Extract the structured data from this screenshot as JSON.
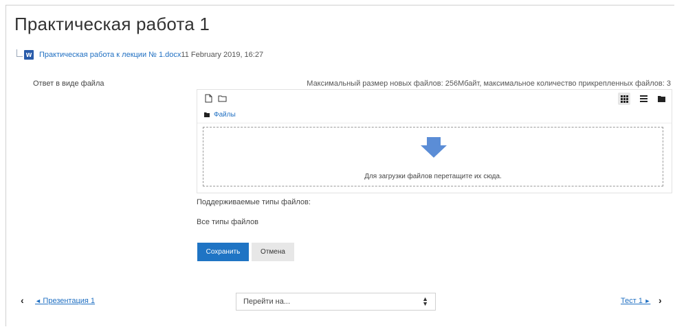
{
  "page": {
    "title": "Практическая работа 1"
  },
  "attachment": {
    "icon": "word-document-icon",
    "link_text": "Практическая работа к лекции № 1.docx",
    "date": "11 February 2019, 16:27"
  },
  "submission": {
    "field_label": "Ответ в виде файла",
    "limits_text": "Максимальный размер новых файлов: 256Мбайт, максимальное количество прикрепленных файлов: 3"
  },
  "file_manager": {
    "toolbar": {
      "add_file_icon": "file-icon",
      "create_folder_icon": "folder-outline-icon",
      "view_icons": "grid-view-icon",
      "view_list": "list-view-icon",
      "view_tree": "tree-view-icon"
    },
    "path_label": "Файлы",
    "drop_text": "Для загрузки файлов перетащите их сюда.",
    "arrow_color": "#5b8dd6"
  },
  "accepted_types": {
    "label": "Поддерживаемые типы файлов:",
    "value": "Все типы файлов"
  },
  "buttons": {
    "save": "Сохранить",
    "cancel": "Отмена"
  },
  "navigation": {
    "prev_label": "Презентация 1",
    "jump_placeholder": "Перейти на...",
    "next_label": "Тест 1"
  },
  "colors": {
    "link": "#1f6fc2",
    "primary_button": "#1f74c4"
  }
}
